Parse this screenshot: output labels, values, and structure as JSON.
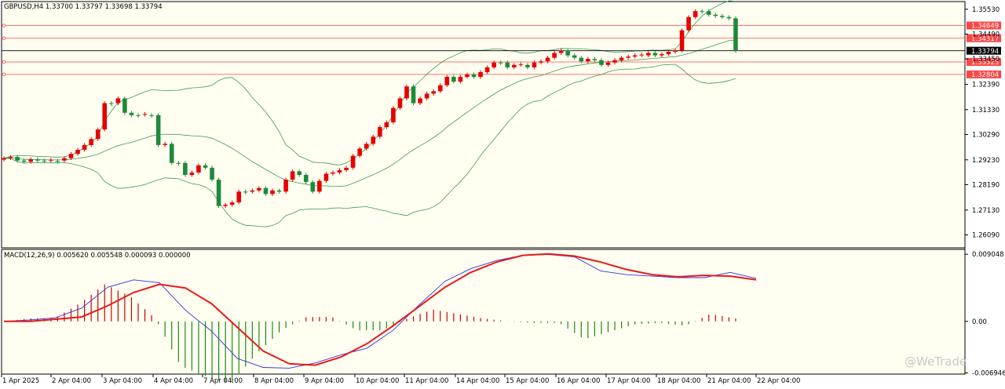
{
  "symbol_info": "GBPUSD,H4  1.33700 1.33797 1.33698 1.33794",
  "macd_info": "MACD(12,26,9) 0.005620 0.005548 0.000093 0.000000",
  "watermark": "@WeTrade",
  "colors": {
    "background": "#fffef0",
    "bull": "#e60000",
    "bear": "#1e8a3c",
    "bands": "#3c9a5a",
    "macd_line": "#3333dd",
    "signal_line": "#e61a1a",
    "hist_pos": "#cc0000",
    "hist_neg": "#1a8a1a",
    "level": "#ff4444",
    "current_price": "#000000"
  },
  "chart_data": [
    {
      "type": "candlestick",
      "title": "GBPUSD,H4",
      "ylim": [
        1.2555,
        1.3585
      ],
      "y_ticks": [
        "1.35530",
        "1.34490",
        "1.33450",
        "1.32390",
        "1.31330",
        "1.30290",
        "1.29230",
        "1.28190",
        "1.27130",
        "1.26090"
      ],
      "x_ticks": [
        "1 Apr 2025",
        "2 Apr 04:00",
        "3 Apr 04:00",
        "4 Apr 04:00",
        "7 Apr 04:00",
        "8 Apr 04:00",
        "9 Apr 04:00",
        "10 Apr 04:00",
        "11 Apr 04:00",
        "14 Apr 04:00",
        "15 Apr 04:00",
        "16 Apr 04:00",
        "17 Apr 04:00",
        "18 Apr 04:00",
        "21 Apr 04:00",
        "22 Apr 04:00"
      ],
      "price_levels": [
        "1.34849",
        "1.34317",
        "1.33325",
        "1.32804"
      ],
      "current_price": "1.33794",
      "close_values": [
        1.293,
        1.2935,
        1.292,
        1.2915,
        1.2925,
        1.292,
        1.292,
        1.2918,
        1.292,
        1.293,
        1.2948,
        1.2965,
        1.2985,
        1.301,
        1.305,
        1.316,
        1.316,
        1.318,
        1.312,
        1.311,
        1.3112,
        1.311,
        1.311,
        1.2985,
        1.299,
        1.291,
        1.291,
        1.286,
        1.287,
        1.29,
        1.289,
        1.284,
        1.273,
        1.2735,
        1.2745,
        1.279,
        1.279,
        1.2795,
        1.2805,
        1.278,
        1.2795,
        1.279,
        1.284,
        1.2875,
        1.286,
        1.283,
        1.279,
        1.2835,
        1.2865,
        1.287,
        1.288,
        1.289,
        1.294,
        1.297,
        1.299,
        1.302,
        1.306,
        1.308,
        1.314,
        1.318,
        1.323,
        1.316,
        1.318,
        1.32,
        1.321,
        1.3235,
        1.327,
        1.325,
        1.327,
        1.328,
        1.327,
        1.329,
        1.331,
        1.333,
        1.333,
        1.331,
        1.332,
        1.332,
        1.331,
        1.333,
        1.3335,
        1.335,
        1.337,
        1.338,
        1.336,
        1.335,
        1.3335,
        1.3345,
        1.334,
        1.332,
        1.333,
        1.334,
        1.335,
        1.3355,
        1.336,
        1.336,
        1.337,
        1.336,
        1.3365,
        1.3375,
        1.338,
        1.3465,
        1.352,
        1.3545,
        1.3545,
        1.353,
        1.3525,
        1.352,
        1.3515,
        1.3379
      ],
      "note": "candle OHLC series estimated from the image"
    },
    {
      "type": "line",
      "title": "MACD(12,26,9)",
      "ylim": [
        -0.0071,
        0.0097
      ],
      "y_ticks": [
        "0.009048",
        "0.00",
        "-0.006946"
      ],
      "series": [
        {
          "name": "MACD",
          "values": [
            0.0,
            0.0002,
            0.0005,
            0.0018,
            0.0046,
            0.0056,
            0.0052,
            0.0015,
            -0.0013,
            -0.005,
            -0.0062,
            -0.0063,
            -0.0056,
            -0.0045,
            -0.0036,
            -0.0012,
            0.0022,
            0.0054,
            0.0071,
            0.0082,
            0.0089,
            0.009,
            0.0087,
            0.0068,
            0.0063,
            0.0061,
            0.0059,
            0.0059,
            0.0066,
            0.0058
          ]
        },
        {
          "name": "Signal",
          "values": [
            0.0,
            0.0,
            0.0003,
            0.0006,
            0.0021,
            0.0039,
            0.005,
            0.0045,
            0.0024,
            -0.0008,
            -0.004,
            -0.0057,
            -0.0059,
            -0.0048,
            -0.003,
            -0.0006,
            0.002,
            0.0046,
            0.0066,
            0.008,
            0.0089,
            0.0091,
            0.0088,
            0.008,
            0.007,
            0.0063,
            0.006,
            0.0062,
            0.0061,
            0.0056
          ]
        }
      ]
    }
  ]
}
